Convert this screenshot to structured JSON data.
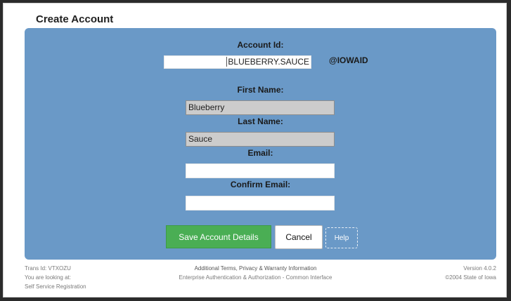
{
  "page": {
    "title": "Create Account"
  },
  "form": {
    "account_id": {
      "label": "Account Id:",
      "prefix_value": "",
      "value": "BLUEBERRY.SAUCE",
      "suffix": "@IOWAID"
    },
    "first_name": {
      "label": "First Name:",
      "value": "Blueberry"
    },
    "last_name": {
      "label": "Last Name:",
      "value": "Sauce"
    },
    "email": {
      "label": "Email:",
      "value": ""
    },
    "confirm_email": {
      "label": "Confirm Email:",
      "value": ""
    }
  },
  "buttons": {
    "save": "Save Account Details",
    "cancel": "Cancel",
    "help": "Help"
  },
  "colors": {
    "panel": "#6a99c7",
    "save_button": "#4aae54"
  },
  "footer": {
    "trans_id": "Trans Id:   VTXOZU",
    "looking_at": "You are looking at:",
    "location": "Self Service Registration",
    "terms": "Additional Terms, Privacy & Warranty Information",
    "subtitle": "Enterprise Authentication & Authorization - Common Interface",
    "version": "Version   4.0.2",
    "copyright": "©2004 State of Iowa"
  }
}
